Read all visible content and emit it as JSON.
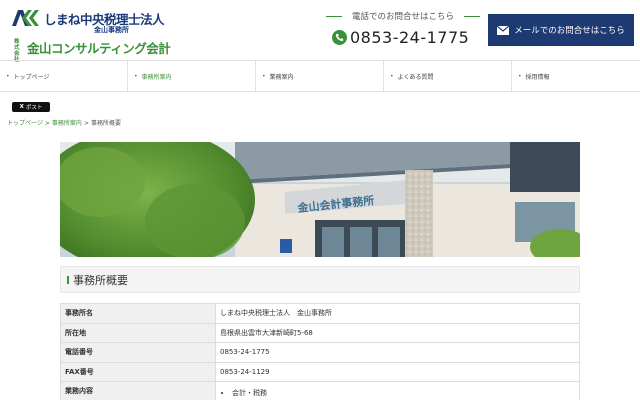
{
  "header": {
    "logo_mark_text": "A",
    "firm_name": "しまね中央税理士法人",
    "office_name": "金山事務所",
    "company_prefix": "株式会社",
    "company_name": "金山コンサルティング会計",
    "tel_caption": "電話でのお問合せはこちら",
    "tel_number": "0853-24-1775",
    "mail_button_label": "メールでのお問合せはこちら",
    "brand_navy": "#1d3a72",
    "brand_green": "#3a8f3a"
  },
  "nav": {
    "items": [
      {
        "label": "トップページ",
        "active": false
      },
      {
        "label": "事務所案内",
        "active": true
      },
      {
        "label": "業務案内",
        "active": false
      },
      {
        "label": "よくある質問",
        "active": false
      },
      {
        "label": "採用情報",
        "active": false
      }
    ]
  },
  "share": {
    "post_label": "ポスト",
    "x_glyph": "X"
  },
  "breadcrumb": {
    "home": "トップページ",
    "parent": "事務所案内",
    "current": "事務所概要",
    "separator": ">"
  },
  "hero": {
    "sign_text": "金山会計事務所"
  },
  "section": {
    "title": "事務所概要"
  },
  "office_table": {
    "rows": [
      {
        "label": "事務所名",
        "value": "しまね中央税理士法人　金山事務所"
      },
      {
        "label": "所在地",
        "value": "島根県出雲市大津新崎町5-68"
      },
      {
        "label": "電話番号",
        "value": "0853-24-1775"
      },
      {
        "label": "FAX番号",
        "value": "0853-24-1129"
      },
      {
        "label": "業務内容",
        "value_list": [
          "会計・税務"
        ]
      }
    ]
  }
}
